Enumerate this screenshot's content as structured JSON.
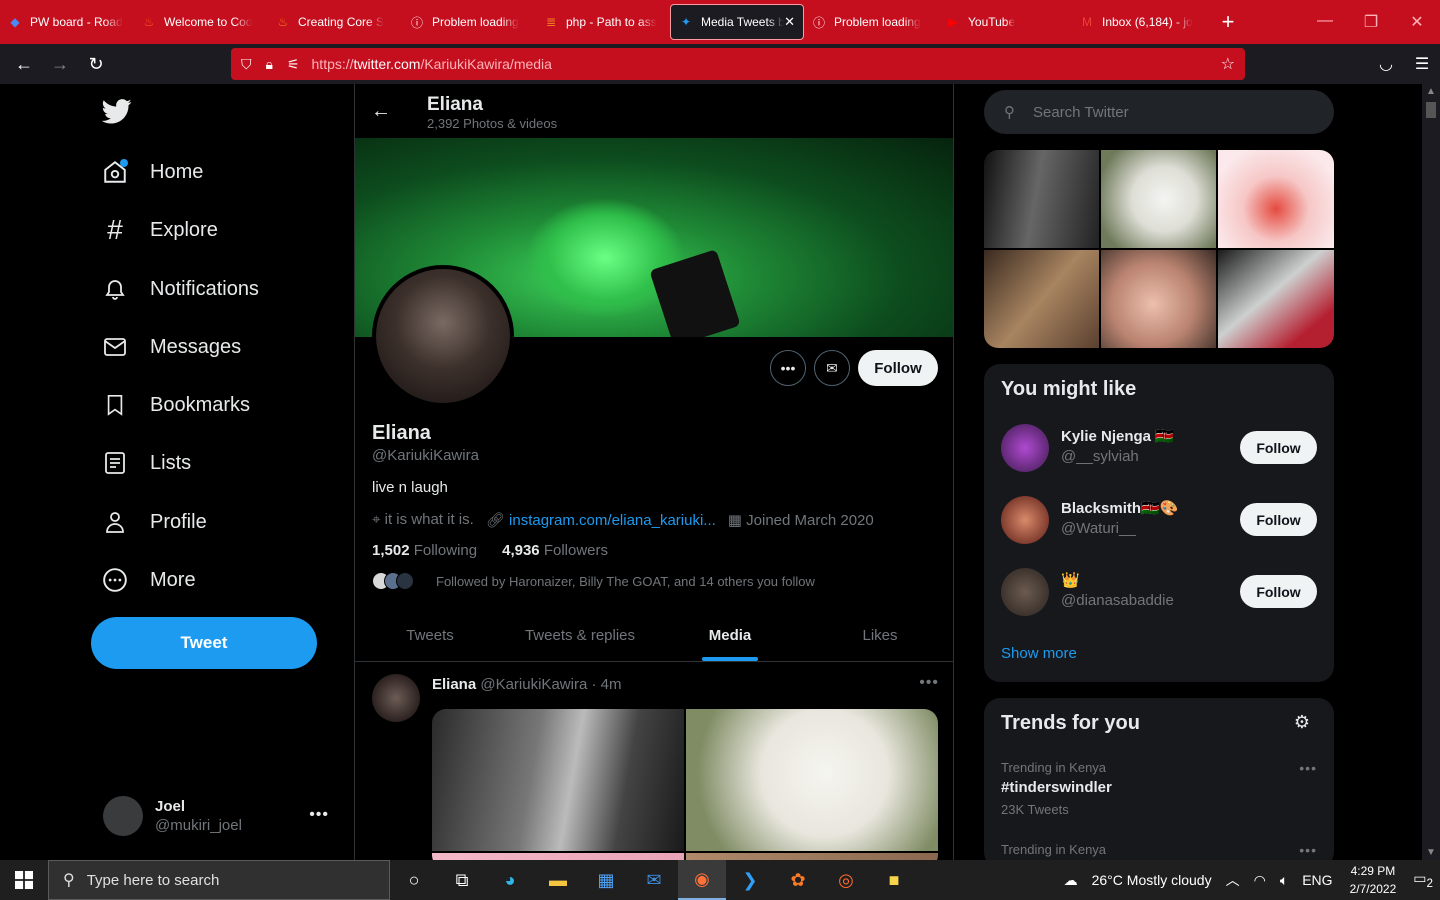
{
  "browser": {
    "tabs": [
      {
        "label": "PW board - Road",
        "icon": "diamond-icon"
      },
      {
        "label": "Welcome to Cod",
        "icon": "flame-icon"
      },
      {
        "label": "Creating Core S",
        "icon": "flame-icon"
      },
      {
        "label": "Problem loading",
        "icon": "info-icon"
      },
      {
        "label": "php - Path to ass",
        "icon": "stack-icon"
      },
      {
        "label": "Media Tweets b",
        "icon": "twitter-icon",
        "active": true
      },
      {
        "label": "Problem loading",
        "icon": "info-icon"
      },
      {
        "label": "YouTube",
        "icon": "youtube-icon"
      },
      {
        "label": "Inbox (6,184) - jo",
        "icon": "gmail-icon"
      }
    ],
    "url_prefix": "https://",
    "url_host": "twitter.com",
    "url_path": "/KariukiKawira/media",
    "accent": "#c50f1f"
  },
  "nav": {
    "items": [
      {
        "label": "Home"
      },
      {
        "label": "Explore"
      },
      {
        "label": "Notifications"
      },
      {
        "label": "Messages"
      },
      {
        "label": "Bookmarks"
      },
      {
        "label": "Lists"
      },
      {
        "label": "Profile"
      },
      {
        "label": "More"
      }
    ],
    "tweet_button": "Tweet",
    "account": {
      "name": "Joel",
      "handle": "@mukiri_joel"
    }
  },
  "profile": {
    "header_name": "Eliana",
    "header_sub": "2,392 Photos & videos",
    "name": "Eliana",
    "handle": "@KariukiKawira",
    "bio": "live n laugh",
    "location": "it is what it is.",
    "link": "instagram.com/eliana_kariuki...",
    "joined": "Joined March 2020",
    "following_count": "1,502",
    "following_label": "Following",
    "followers_count": "4,936",
    "followers_label": "Followers",
    "followed_by": "Followed by Haronaizer, Billy The GOAT, and 14 others you follow",
    "follow_button": "Follow",
    "tabs": [
      "Tweets",
      "Tweets & replies",
      "Media",
      "Likes"
    ],
    "active_tab": "Media"
  },
  "tweet": {
    "name": "Eliana",
    "handle": "@KariukiKawira",
    "time": "· 4m"
  },
  "sidebar": {
    "search_placeholder": "Search Twitter",
    "might_like_title": "You might like",
    "suggestions": [
      {
        "name": "Kylie Njenga 🇰🇪",
        "handle": "@__sylviah",
        "button": "Follow"
      },
      {
        "name": "Blacksmith🇰🇪🎨",
        "handle": "@Waturi__",
        "button": "Follow"
      },
      {
        "name": "👑",
        "handle": "@dianasabaddie",
        "button": "Follow"
      }
    ],
    "show_more": "Show more",
    "trends_title": "Trends for you",
    "trends": [
      {
        "context": "Trending in Kenya",
        "topic": "#tinderswindler",
        "count": "23K Tweets"
      },
      {
        "context": "Trending in Kenya",
        "topic": "",
        "count": ""
      }
    ]
  },
  "taskbar": {
    "search_placeholder": "Type here to search",
    "weather": "26°C  Mostly cloudy",
    "lang": "ENG",
    "time": "4:29 PM",
    "date": "2/7/2022",
    "notif_count": "2"
  }
}
